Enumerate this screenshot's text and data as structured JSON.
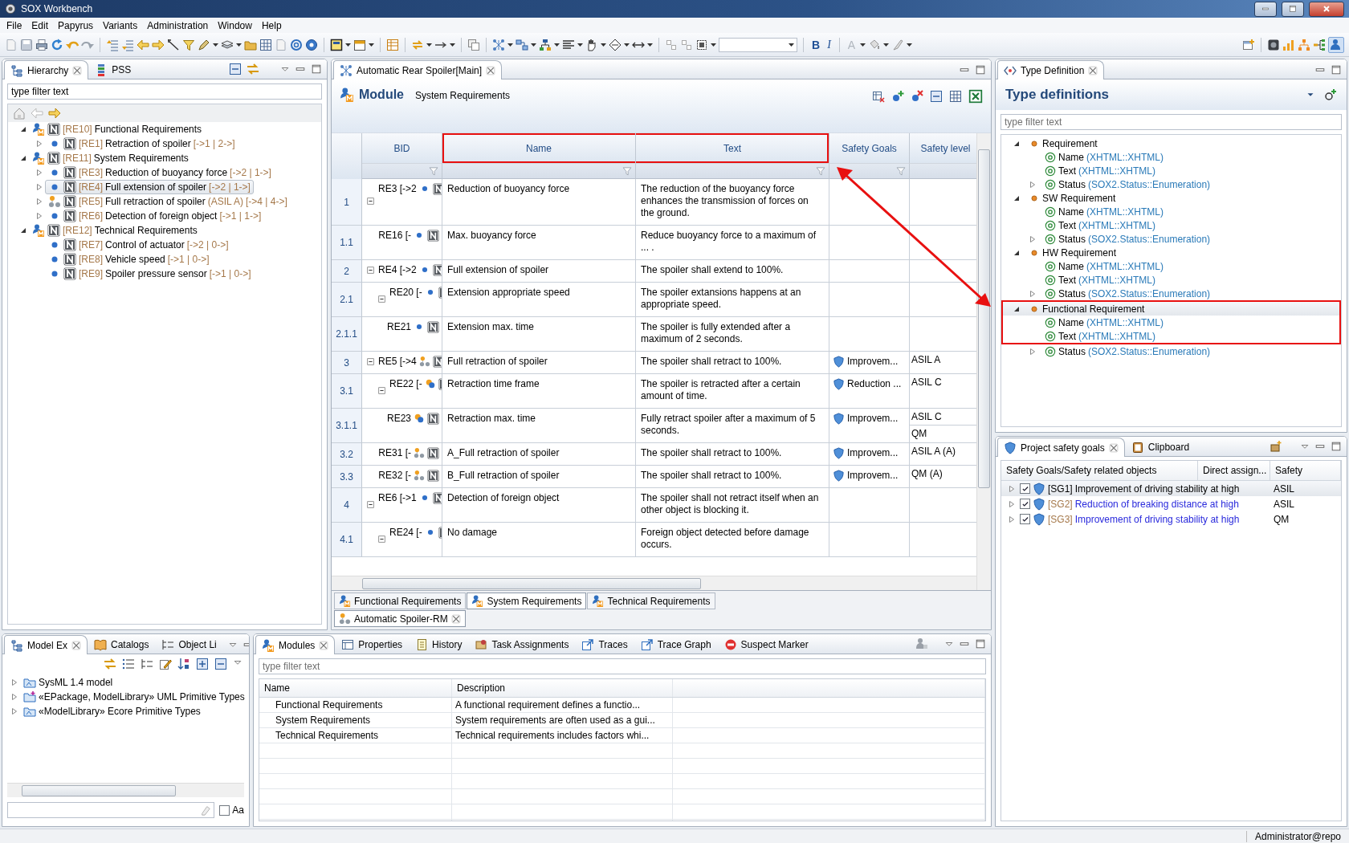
{
  "window": {
    "title": "SOX Workbench"
  },
  "menu": [
    "File",
    "Edit",
    "Papyrus",
    "Variants",
    "Administration",
    "Window",
    "Help"
  ],
  "toolbar": {
    "format_buttons": [
      {
        "label": "B",
        "kind": "bold",
        "disabled": false
      },
      {
        "label": "I",
        "kind": "italic",
        "disabled": false
      },
      {
        "label": "A",
        "kind": "color",
        "disabled": true
      }
    ]
  },
  "hierarchy": {
    "tabs": [
      {
        "label": "Hierarchy",
        "selected": true
      },
      {
        "label": "PSS",
        "selected": false
      }
    ],
    "filter": {
      "value": "type filter text"
    },
    "tree": [
      {
        "kind": "module",
        "id": "[RE10]",
        "name": "Functional Requirements",
        "expanded": true,
        "selected": false,
        "children": [
          {
            "kind": "requirement",
            "id": "[RE1]",
            "name": "Retraction of spoiler",
            "links": "[->1 | 2->]",
            "expanded": false,
            "selected": false
          }
        ]
      },
      {
        "kind": "module",
        "id": "[RE11]",
        "name": "System Requirements",
        "expanded": true,
        "selected": false,
        "children": [
          {
            "kind": "requirement",
            "id": "[RE3]",
            "name": "Reduction of buoyancy force",
            "links": "[->2 | 1->]",
            "expanded": false,
            "selected": false
          },
          {
            "kind": "requirement",
            "id": "[RE4]",
            "name": "Full extension of spoiler",
            "links": "[->2 | 1->]",
            "expanded": false,
            "selected": true
          },
          {
            "kind": "composite",
            "id": "[RE5]",
            "name": "Full retraction of spoiler",
            "asil": "(ASIL A)",
            "links": "[->4 | 4->]",
            "expanded": false,
            "selected": false
          },
          {
            "kind": "requirement",
            "id": "[RE6]",
            "name": "Detection of foreign object",
            "links": "[->1 | 1->]",
            "expanded": false,
            "selected": false
          }
        ]
      },
      {
        "kind": "module",
        "id": "[RE12]",
        "name": "Technical Requirements",
        "expanded": true,
        "selected": false,
        "children": [
          {
            "kind": "requirement",
            "id": "[RE7]",
            "name": "Control of actuator",
            "links": "[->2 | 0->]",
            "selected": false
          },
          {
            "kind": "requirement",
            "id": "[RE8]",
            "name": "Vehicle speed",
            "links": "[->1 | 0->]",
            "selected": false
          },
          {
            "kind": "requirement",
            "id": "[RE9]",
            "name": "Spoiler pressure sensor",
            "links": "[->1 | 0->]",
            "selected": false
          }
        ]
      }
    ]
  },
  "editor": {
    "tab": {
      "label": "Automatic Rear Spoiler[Main]"
    },
    "header": {
      "title": "Module",
      "subtitle": "System Requirements"
    },
    "columns": [
      {
        "label": "BID",
        "highlighted": false,
        "filter": true
      },
      {
        "label": "Name",
        "highlighted": true,
        "filter": true
      },
      {
        "label": "Text",
        "highlighted": true,
        "filter": true
      },
      {
        "label": "Safety Goals",
        "highlighted": false,
        "filter": true
      },
      {
        "label": "Safety level",
        "highlighted": false,
        "filter": false
      }
    ],
    "rows": [
      {
        "number": "1",
        "bid": "RE3 [->2",
        "kind": "dot",
        "expanded": true,
        "name": "Reduction of buoyancy force",
        "text": "The reduction of the buoyancy force enhances the transmission of forces on the ground.",
        "children": [
          {
            "number": "1.1",
            "bid": "RE16 [-",
            "kind": "dot",
            "name": "Max. buoyancy force",
            "text": "Reduce buoyancy force to a maximum of ... ."
          }
        ]
      },
      {
        "number": "2",
        "bid": "RE4 [->2",
        "kind": "dot",
        "expanded": true,
        "name": "Full extension of spoiler",
        "text": "The spoiler shall extend to 100%.",
        "children": [
          {
            "number": "2.1",
            "bid": "RE20 [-",
            "kind": "dot",
            "expanded": true,
            "name": "Extension appropriate speed",
            "text": "The spoiler extansions happens at an appropriate speed.",
            "children": [
              {
                "number": "2.1.1",
                "bid": "RE21",
                "kind": "dot",
                "name": "Extension max. time",
                "text": "The spoiler is fully extended after a maximum of 2 seconds."
              }
            ]
          }
        ]
      },
      {
        "number": "3",
        "bid": "RE5 [->4",
        "kind": "cluster",
        "expanded": true,
        "name": "Full retraction of spoiler",
        "text": "The spoiler shall retract to 100%.",
        "goals": [
          "Improvem..."
        ],
        "levels": [
          "ASIL A"
        ],
        "children": [
          {
            "number": "3.1",
            "bid": "RE22 [-",
            "kind": "pair",
            "expanded": true,
            "name": "Retraction time frame",
            "text": "The spoiler is retracted after a certain amount of time.",
            "goals": [
              "Reduction ..."
            ],
            "levels": [
              "ASIL C"
            ],
            "children": [
              {
                "number": "3.1.1",
                "bid": "RE23",
                "kind": "pair",
                "name": "Retraction max. time",
                "text": "Fully retract spoiler after a maximum of 5 seconds.",
                "goals": [
                  "Improvem..."
                ],
                "levels": [
                  "ASIL C",
                  "QM"
                ]
              }
            ]
          },
          {
            "number": "3.2",
            "bid": "RE31 [-",
            "kind": "cluster",
            "name": "A_Full retraction of spoiler",
            "text": "The spoiler shall retract to 100%.",
            "goals": [
              "Improvem..."
            ],
            "levels": [
              "ASIL A (A)"
            ]
          },
          {
            "number": "3.3",
            "bid": "RE32 [-",
            "kind": "cluster",
            "name": "B_Full retraction of spoiler",
            "text": "The spoiler shall retract to 100%.",
            "goals": [
              "Improvem..."
            ],
            "levels": [
              "QM (A)"
            ]
          }
        ]
      },
      {
        "number": "4",
        "bid": "RE6 [->1",
        "kind": "dot",
        "expanded": true,
        "name": "Detection of foreign object",
        "text": "The spoiler shall not retract itself when an other object is blocking it.",
        "children": [
          {
            "number": "4.1",
            "bid": "RE24 [-",
            "kind": "dot",
            "expanded": true,
            "name": "No damage",
            "text": "Foreign object detected before damage occurs."
          }
        ]
      }
    ],
    "module_tabs": [
      {
        "label": "Functional Requirements",
        "selected": false
      },
      {
        "label": "System Requirements",
        "selected": true
      },
      {
        "label": "Technical Requirements",
        "selected": false
      }
    ],
    "document_tab": {
      "label": "Automatic Spoiler-RM"
    }
  },
  "type_definition": {
    "tab": {
      "label": "Type Definition"
    },
    "title": "Type definitions",
    "filter": {
      "placeholder": "type filter text"
    },
    "types": [
      {
        "name": "Requirement",
        "expanded": true,
        "selected": false,
        "highlighted": false,
        "children": [
          {
            "name": "Name",
            "type": "(XHTML::XHTML)",
            "selected": false,
            "highlighted": false
          },
          {
            "name": "Text",
            "type": "(XHTML::XHTML)",
            "selected": false,
            "highlighted": false
          },
          {
            "name": "Status",
            "type": "(SOX2.Status::Enumeration)",
            "expanded": false,
            "selected": false,
            "highlighted": false
          }
        ]
      },
      {
        "name": "SW Requirement",
        "expanded": true,
        "selected": false,
        "highlighted": false,
        "children": [
          {
            "name": "Name",
            "type": "(XHTML::XHTML)",
            "selected": false,
            "highlighted": false
          },
          {
            "name": "Text",
            "type": "(XHTML::XHTML)",
            "selected": false,
            "highlighted": false
          },
          {
            "name": "Status",
            "type": "(SOX2.Status::Enumeration)",
            "expanded": false,
            "selected": false,
            "highlighted": false
          }
        ]
      },
      {
        "name": "HW Requirement",
        "expanded": true,
        "selected": false,
        "highlighted": false,
        "children": [
          {
            "name": "Name",
            "type": "(XHTML::XHTML)",
            "selected": false,
            "highlighted": false
          },
          {
            "name": "Text",
            "type": "(XHTML::XHTML)",
            "selected": false,
            "highlighted": false
          },
          {
            "name": "Status",
            "type": "(SOX2.Status::Enumeration)",
            "expanded": false,
            "selected": false,
            "highlighted": false
          }
        ]
      },
      {
        "name": "Functional Requirement",
        "expanded": true,
        "selected": true,
        "highlighted": true,
        "children": [
          {
            "name": "Name",
            "type": "(XHTML::XHTML)",
            "selected": false,
            "highlighted": true
          },
          {
            "name": "Text",
            "type": "(XHTML::XHTML)",
            "selected": false,
            "highlighted": true
          },
          {
            "name": "Status",
            "type": "(SOX2.Status::Enumeration)",
            "expanded": false,
            "selected": false,
            "highlighted": false
          }
        ]
      }
    ]
  },
  "safety_goals": {
    "tabs": [
      {
        "label": "Project safety goals",
        "selected": true
      },
      {
        "label": "Clipboard",
        "selected": false
      }
    ],
    "columns": [
      "Safety Goals/Safety related objects",
      "Direct assign...",
      "Safety"
    ],
    "rows": [
      {
        "id": "[SG1]",
        "name": "Improvement of driving stability at high",
        "safety": "ASIL",
        "checked": true,
        "expanded": false,
        "selected": true
      },
      {
        "id": "[SG2]",
        "name": "Reduction of breaking distance at high",
        "safety": "ASIL",
        "checked": true,
        "expanded": false,
        "selected": false
      },
      {
        "id": "[SG3]",
        "name": "Improvement of driving stability at high",
        "safety": "QM",
        "checked": true,
        "expanded": false,
        "selected": false
      }
    ]
  },
  "model_explorer": {
    "tabs": [
      {
        "label": "Model Ex",
        "selected": true
      },
      {
        "label": "Catalogs",
        "selected": false
      },
      {
        "label": "Object Li",
        "selected": false
      }
    ],
    "items": [
      {
        "name": "SysML 1.4 model",
        "expanded": false
      },
      {
        "name": "«EPackage, ModelLibrary» UML Primitive Types",
        "expanded": false
      },
      {
        "name": "«ModelLibrary» Ecore Primitive Types",
        "expanded": false
      }
    ],
    "match_case": {
      "label": "Aa",
      "checked": false
    }
  },
  "modules_view": {
    "tabs": [
      {
        "label": "Modules",
        "selected": true
      },
      {
        "label": "Properties",
        "selected": false
      },
      {
        "label": "History",
        "selected": false
      },
      {
        "label": "Task Assignments",
        "selected": false
      },
      {
        "label": "Traces",
        "selected": false
      },
      {
        "label": "Trace Graph",
        "selected": false
      },
      {
        "label": "Suspect Marker",
        "selected": false
      }
    ],
    "filter": {
      "placeholder": "type filter text"
    },
    "columns": [
      "Name",
      "Description"
    ],
    "rows": [
      {
        "name": "Functional Requirements",
        "description": "A functional requirement defines a functio..."
      },
      {
        "name": "System Requirements",
        "description": "System requirements are often used as a gui..."
      },
      {
        "name": "Technical Requirements",
        "description": "Technical requirements includes factors whi..."
      }
    ]
  },
  "status_bar": {
    "user": "Administrator@repo"
  }
}
